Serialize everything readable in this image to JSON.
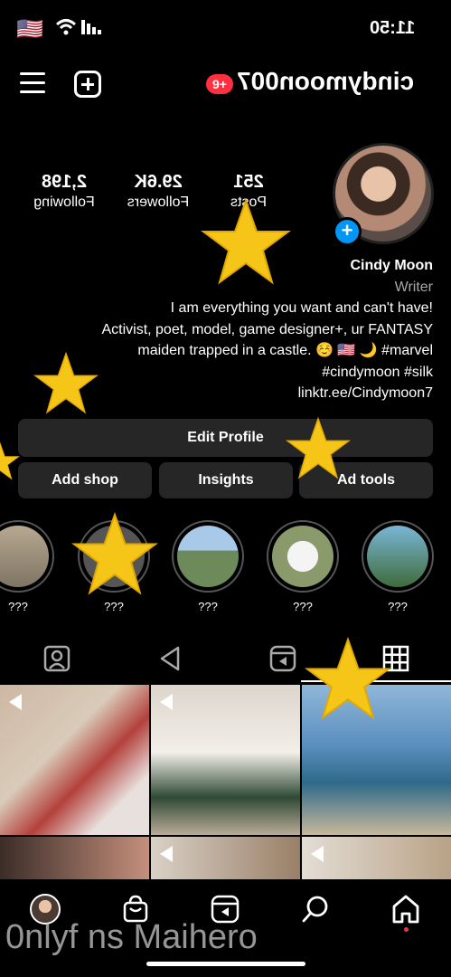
{
  "status_bar": {
    "flag": "🇺🇸",
    "time": "11:50"
  },
  "header": {
    "notifications": "9+",
    "username": "cindymoon007"
  },
  "stats": {
    "following": {
      "value": "2,198",
      "label": "Following"
    },
    "followers": {
      "value": "29.6K",
      "label": "Followers"
    },
    "posts": {
      "value": "251",
      "label": "Posts"
    }
  },
  "profile": {
    "name": "Cindy Moon",
    "category": "Writer",
    "bio_lines": [
      "I am everything you want and can't have!",
      "Activist, poet, model, game designer+, ur FANTASY",
      "maiden trapped in a castle. ☺️ 🇺🇸 🌙 #marvel",
      "#cindymoon #silk",
      "linktr.ee/Cindymoon7"
    ]
  },
  "buttons": {
    "edit_profile": "Edit Profile",
    "ad_tools": "Ad tools",
    "insights": "Insights",
    "add_shop": "Add shop"
  },
  "highlights": [
    "???",
    "???",
    "???",
    "???",
    "???"
  ],
  "watermark": "0nlyf ns Maihero",
  "colors": {
    "accent_blue": "#0095f6",
    "badge_red": "#ff3040",
    "button_bg": "#262626"
  }
}
